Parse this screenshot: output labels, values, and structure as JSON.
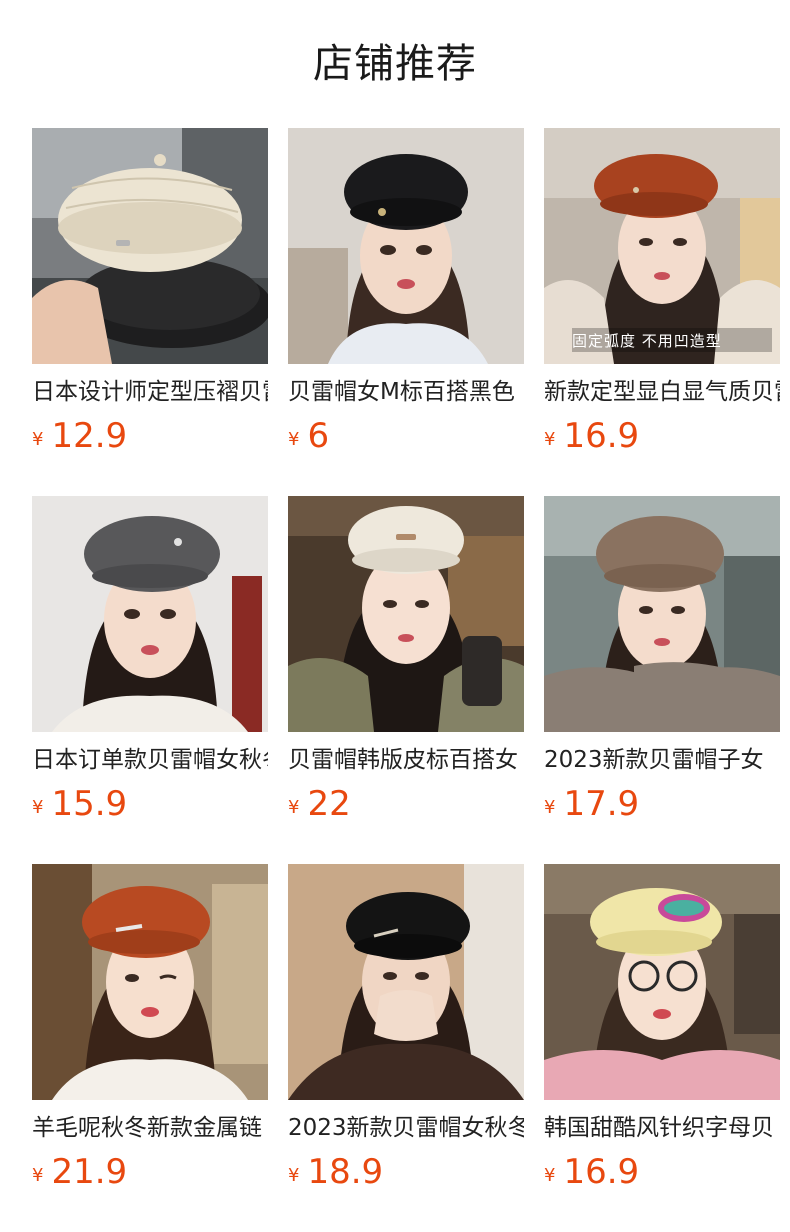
{
  "page": {
    "title": "店铺推荐"
  },
  "colors": {
    "price": "#e8480f",
    "text": "#222222",
    "title": "#1a1a1a"
  },
  "products": [
    {
      "name": "日本设计师定型压褶贝雷帽",
      "currency": "¥",
      "price": "12.9",
      "image": "knit-beret-stack"
    },
    {
      "name": "贝雷帽女M标百搭黑色",
      "currency": "¥",
      "price": "6",
      "image": "black-beret-portrait"
    },
    {
      "name": "新款定型显白显气质贝雷帽",
      "currency": "¥",
      "price": "16.9",
      "image": "rust-beret-portrait",
      "overlay": "固定弧度 不用凹造型"
    },
    {
      "name": "日本订单款贝雷帽女秋冬",
      "currency": "¥",
      "price": "15.9",
      "image": "grey-beret-portrait"
    },
    {
      "name": "贝雷帽韩版皮标百搭女",
      "currency": "¥",
      "price": "22",
      "image": "cream-beret-portrait"
    },
    {
      "name": "2023新款贝雷帽子女",
      "currency": "¥",
      "price": "17.9",
      "image": "brown-beret-portrait"
    },
    {
      "name": "羊毛呢秋冬新款金属链",
      "currency": "¥",
      "price": "21.9",
      "image": "orange-beret-portrait"
    },
    {
      "name": "2023新款贝雷帽女秋冬",
      "currency": "¥",
      "price": "18.9",
      "image": "black-beret-portrait-2"
    },
    {
      "name": "韩国甜酷风针织字母贝",
      "currency": "¥",
      "price": "16.9",
      "image": "yellow-beret-portrait"
    }
  ]
}
